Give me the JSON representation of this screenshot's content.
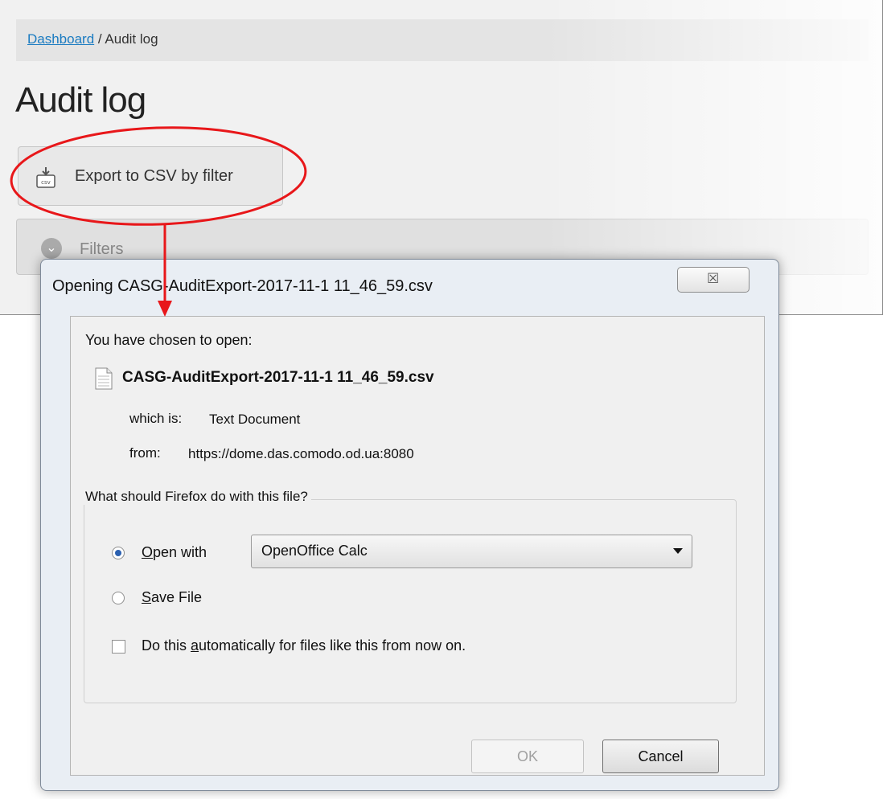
{
  "page": {
    "breadcrumb": {
      "link": "Dashboard",
      "separator": " / ",
      "current": "Audit log"
    },
    "title": "Audit log",
    "export_button": {
      "label": "Export to CSV by filter",
      "icon": "csv-download-icon"
    },
    "filters": {
      "label": "Filters",
      "icon": "chevron-down-icon"
    }
  },
  "dialog": {
    "title": "Opening CASG-AuditExport-2017-11-1 11_46_59.csv",
    "close_label": "☒",
    "chosen_text": "You have chosen to open:",
    "file_name": "CASG-AuditExport-2017-11-1 11_46_59.csv",
    "which_label": "which is:",
    "which_value": "Text Document",
    "from_label": "from:",
    "from_value": "https://dome.das.comodo.od.ua:8080",
    "question": "What should Firefox do with this file?",
    "open_with": {
      "label_prefix": "O",
      "label_rest": "pen with",
      "selected": true
    },
    "application": "OpenOffice Calc",
    "save_file": {
      "label_prefix": "S",
      "label_rest": "ave File",
      "selected": false
    },
    "auto": {
      "label_before": "Do this ",
      "label_u": "a",
      "label_after": "utomatically for files like this from now on.",
      "checked": false
    },
    "ok_label": "OK",
    "cancel_label": "Cancel"
  },
  "colors": {
    "annotation": "#e8171a",
    "link": "#1a7bc1",
    "radio_dot": "#2b60b0"
  }
}
